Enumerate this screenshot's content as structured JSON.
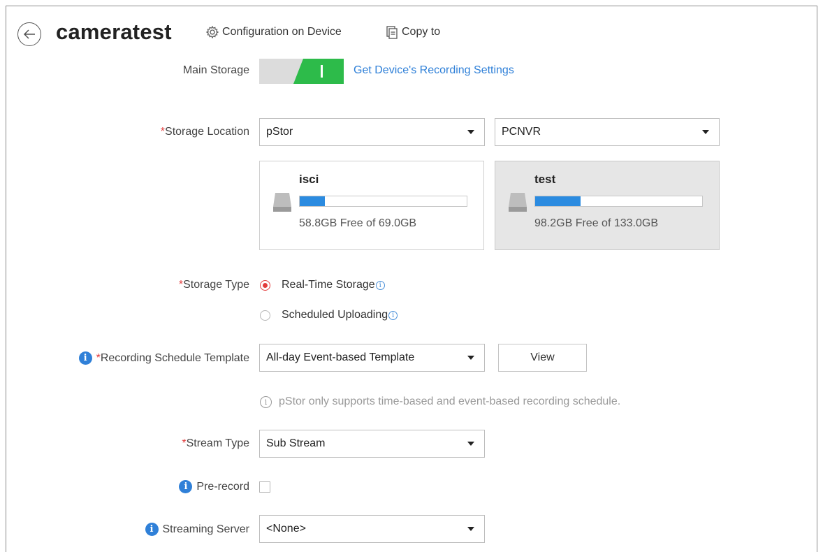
{
  "header": {
    "title": "cameratest",
    "config_label": "Configuration on Device",
    "copy_label": "Copy to"
  },
  "main_storage": {
    "label": "Main Storage",
    "enabled": true,
    "link": "Get Device's Recording Settings"
  },
  "storage_location": {
    "required_mark": "*",
    "label": "Storage Location",
    "type_value": "pStor",
    "server_value": "PCNVR",
    "cards": [
      {
        "name": "isci",
        "free_text": "58.8GB Free of 69.0GB",
        "used_fraction": 0.15,
        "selected": false
      },
      {
        "name": "test",
        "free_text": "98.2GB Free of 133.0GB",
        "used_fraction": 0.27,
        "selected": true
      }
    ]
  },
  "storage_type": {
    "required_mark": "*",
    "label": "Storage Type",
    "options": [
      {
        "label": "Real-Time Storage",
        "checked": true
      },
      {
        "label": "Scheduled Uploading",
        "checked": false
      }
    ],
    "info_glyph": "i"
  },
  "schedule": {
    "required_mark": "*",
    "label": "Recording Schedule Template",
    "value": "All-day Event-based Template",
    "view_button": "View",
    "hint": "pStor only supports time-based and event-based recording schedule."
  },
  "stream_type": {
    "required_mark": "*",
    "label": "Stream Type",
    "value": "Sub Stream"
  },
  "pre_record": {
    "label": "Pre-record",
    "checked": false
  },
  "streaming_server": {
    "label": "Streaming Server",
    "value": "<None>"
  },
  "icons": {
    "back": "back-arrow-icon",
    "config": "gear-icon",
    "copy": "copy-icon",
    "info": "info-icon",
    "disk": "disk-icon",
    "dropdown": "chevron-down-icon"
  },
  "colors": {
    "accent": "#2f80d8",
    "toggle_on": "#2dbb4a",
    "required": "#e23b3b",
    "progress": "#2b8be0"
  }
}
